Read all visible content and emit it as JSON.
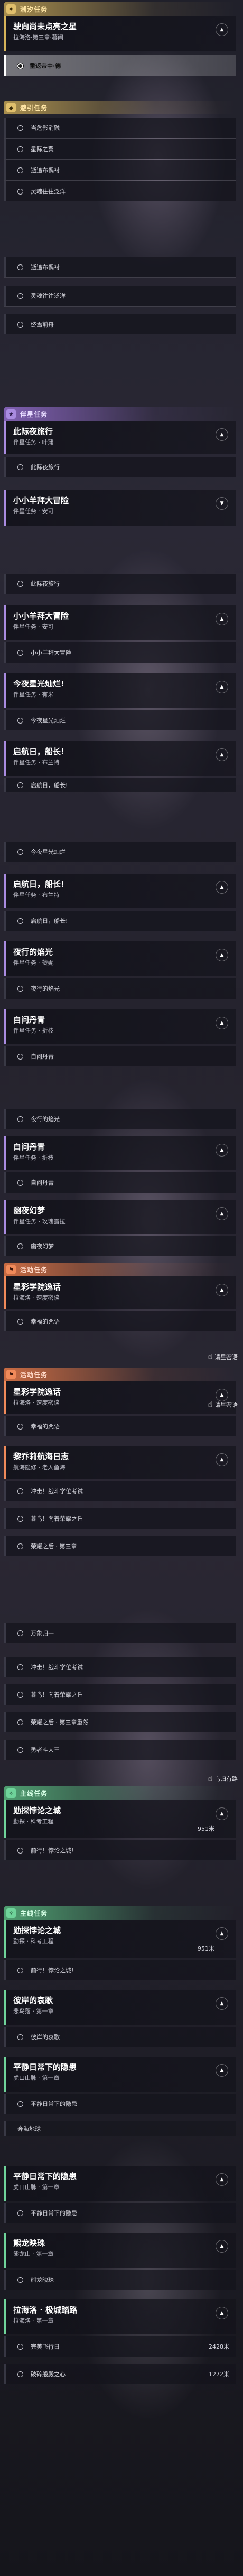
{
  "colors": {
    "gold": "#d6b359",
    "purple": "#a98be0",
    "orange": "#f08a5a",
    "green": "#6fd39a"
  },
  "s1": {
    "header": "潮汐任务",
    "card": {
      "title": "驶向尚未点亮之星",
      "sub": "拉海洛·第三章·暮间"
    },
    "selected": "重返帝中·德"
  },
  "s2": {
    "header": "避引任务",
    "rows": [
      "当危影消融",
      "星际之翼",
      "逝追布偶衬",
      "灵魂往往泛洋"
    ]
  },
  "s3": {
    "rows": [
      "逝追布偶衬",
      "灵魂往往泛洋",
      "终焉前舟"
    ]
  },
  "s4": {
    "header": "伴星任务",
    "c1": {
      "title": "此际夜旅行",
      "sub": "伴星任务 · 叶蒲"
    },
    "r1": "此际夜旅行",
    "c2": {
      "title": "小小羊拜大冒险",
      "sub": "伴星任务 · 安可"
    }
  },
  "s5": {
    "r1": "此际夜旅行",
    "c1": {
      "title": "小小羊拜大冒险",
      "sub": "伴星任务 · 安可"
    },
    "r2": "小小羊拜大冒险",
    "c2": {
      "title": "今夜星光灿烂!",
      "sub": "伴星任务 · 有米"
    },
    "r3": "今夜星光灿烂",
    "c3": {
      "title": "启航日，船长!",
      "sub": "伴星任务 · 布兰特"
    },
    "r4": "启航日，船长!"
  },
  "s6": {
    "r1": "今夜星光灿烂",
    "c1": {
      "title": "启航日，船长!",
      "sub": "伴星任务 · 布兰特"
    },
    "r2": "启航日，船长!",
    "c2": {
      "title": "夜行的焰光",
      "sub": "伴星任务 · 赞妮"
    },
    "r3": "夜行的焰光",
    "c3": {
      "title": "自问丹青",
      "sub": "伴星任务 · 折枝"
    },
    "r4": "自问丹青"
  },
  "s7": {
    "r1": "夜行的焰光",
    "c1": {
      "title": "自问丹青",
      "sub": "伴星任务 · 折枝"
    },
    "r2": "自问丹青",
    "c2": {
      "title": "幽夜幻梦",
      "sub": "伴星任务 · 玫瑰露拉"
    },
    "r3": "幽夜幻梦",
    "header": "活动任务",
    "c3": {
      "title": "星彩学院逸话",
      "sub": "拉海洛 · 速度密谈"
    },
    "r4": "幸福的咒语",
    "toast": "请星密语"
  },
  "s8": {
    "header": "活动任务",
    "c1": {
      "title": "星彩学院逸话",
      "sub": "拉海洛 · 速度密谈"
    },
    "r1": "幸福的咒语",
    "c2": {
      "title": "黎乔莉航海日志",
      "sub": "航海隐修 · 老人鱼海"
    },
    "r2": "冲击！战斗学位考试",
    "r3": "暮鸟！向着荣耀之丘",
    "r4": "荣耀之后 · 第三章",
    "toast": "请星密语"
  },
  "s9": {
    "r1": "万象归一",
    "r2": "冲击！战斗学位考试",
    "r3": "暮鸟！向着荣耀之丘",
    "r4": "荣耀之后 · 第三章重然",
    "r5": "勇者斗大王",
    "toast": "乌归有路",
    "header": "主线任务",
    "c1": {
      "title": "勋探悖论之城",
      "sub": "勤探 · 科考工程",
      "dist": "951米"
    },
    "r6": "前行！悖论之城!"
  },
  "s10": {
    "header": "主线任务",
    "c1": {
      "title": "勋探悖论之城",
      "sub": "勤探 · 科考工程",
      "dist": "951米"
    },
    "r1": "前行！悖论之城!",
    "c2": {
      "title": "彼岸的哀歌",
      "sub": "悲鸟落 · 第一章"
    },
    "r2": "彼岸的哀歌",
    "c3": {
      "title": "平静日常下的隐患",
      "sub": "虎口山脉 · 第一章"
    },
    "r3": "平静日常下的隐患",
    "footer": "奔海地球"
  },
  "s11": {
    "c1": {
      "title": "平静日常下的隐患",
      "sub": "虎口山脉 · 第一章"
    },
    "r1": "平静日常下的隐患",
    "c2": {
      "title": "熊龙映珠",
      "sub": "熊龙山 · 第一章"
    },
    "r2": "熊龙映珠",
    "c3": {
      "title": "拉海洛 · 极城踏路",
      "sub": "拉海洛 · 第一章"
    },
    "r3": {
      "text": "完美飞行日",
      "dist": "2428米"
    },
    "r4": {
      "text": "破碎般殿之心",
      "dist": "1272米"
    }
  }
}
